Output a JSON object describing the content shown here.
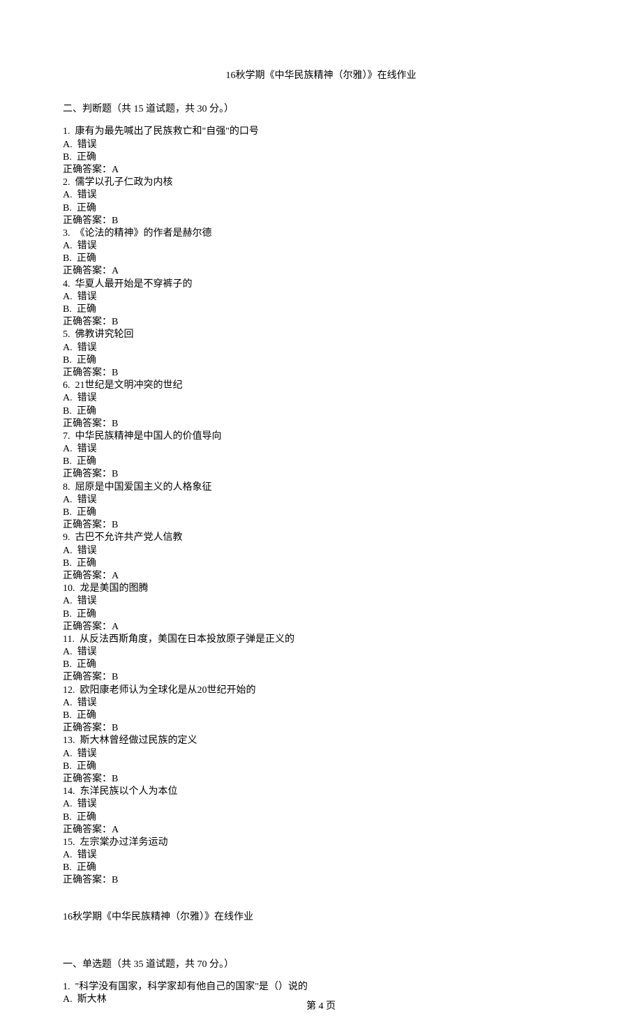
{
  "titleTop": "16秋学期《中华民族精神（尔雅）》在线作业",
  "sectionHeader": "二、判断题（共 15 道试题，共 30 分。）",
  "questions": [
    {
      "num": "1.",
      "text": "  康有为最先喊出了民族救亡和\"自强\"的口号",
      "a": "A.  错误",
      "b": "B.  正确",
      "ans": "正确答案：A"
    },
    {
      "num": "2.",
      "text": "  儒学以孔子仁政为内核",
      "a": "A.  错误",
      "b": "B.  正确",
      "ans": "正确答案：B"
    },
    {
      "num": "3.",
      "text": "  《论法的精神》的作者是赫尔德",
      "a": "A.  错误",
      "b": "B.  正确",
      "ans": "正确答案：A"
    },
    {
      "num": "4.",
      "text": "  华夏人最开始是不穿裤子的",
      "a": "A.  错误",
      "b": "B.  正确",
      "ans": "正确答案：B"
    },
    {
      "num": "5.",
      "text": "  佛教讲究轮回",
      "a": "A.  错误",
      "b": "B.  正确",
      "ans": "正确答案：B"
    },
    {
      "num": "6.",
      "text": "  21世纪是文明冲突的世纪",
      "a": "A.  错误",
      "b": "B.  正确",
      "ans": "正确答案：B"
    },
    {
      "num": "7.",
      "text": "  中华民族精神是中国人的价值导向",
      "a": "A.  错误",
      "b": "B.  正确",
      "ans": "正确答案：B"
    },
    {
      "num": "8.",
      "text": "  屈原是中国爱国主义的人格象征",
      "a": "A.  错误",
      "b": "B.  正确",
      "ans": "正确答案：B"
    },
    {
      "num": "9.",
      "text": "  古巴不允许共产党人信教",
      "a": "A.  错误",
      "b": "B.  正确",
      "ans": "正确答案：A"
    },
    {
      "num": "10.",
      "text": "  龙是美国的图腾",
      "a": "A.  错误",
      "b": "B.  正确",
      "ans": "正确答案：A"
    },
    {
      "num": "11.",
      "text": "  从反法西斯角度，美国在日本投放原子弹是正义的",
      "a": "A.  错误",
      "b": "B.  正确",
      "ans": "正确答案：B"
    },
    {
      "num": "12.",
      "text": "  欧阳康老师认为全球化是从20世纪开始的",
      "a": "A.  错误",
      "b": "B.  正确",
      "ans": "正确答案：B"
    },
    {
      "num": "13.",
      "text": "  斯大林曾经做过民族的定义",
      "a": "A.  错误",
      "b": "B.  正确",
      "ans": "正确答案：B"
    },
    {
      "num": "14.",
      "text": "  东洋民族以个人为本位",
      "a": "A.  错误",
      "b": "B.  正确",
      "ans": "正确答案：A"
    },
    {
      "num": "15.",
      "text": "  左宗棠办过洋务运动",
      "a": "A.  错误",
      "b": "B.  正确",
      "ans": "正确答案：B"
    }
  ],
  "titleBottom": "16秋学期《中华民族精神（尔雅）》在线作业",
  "sectionHeader2": "一、单选题（共 35 道试题，共 70 分。）",
  "bottomQuestion": {
    "num": "1.",
    "text": "  \"科学没有国家，科学家却有他自己的国家\"是（）说的",
    "a": "A.  斯大林"
  },
  "footer": "第 4 页"
}
